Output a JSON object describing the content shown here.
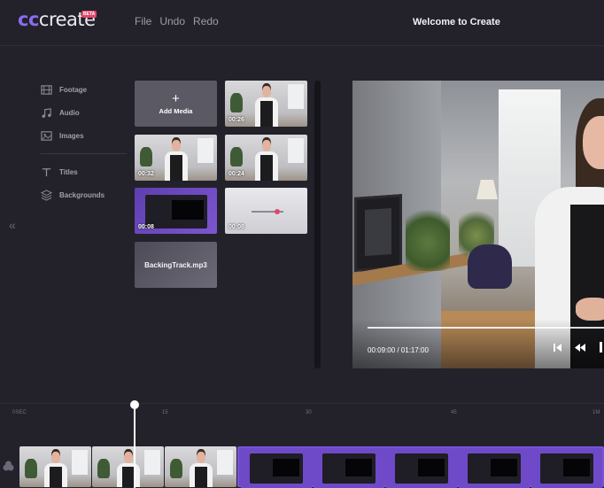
{
  "app": {
    "logo_prefix": "cc",
    "logo_name": "create",
    "badge": "BETA",
    "title": "Welcome to Create"
  },
  "menu": [
    {
      "label": "File"
    },
    {
      "label": "Undo"
    },
    {
      "label": "Redo"
    }
  ],
  "sidebar": {
    "items": [
      {
        "label": "Footage",
        "icon": "film-icon"
      },
      {
        "label": "Audio",
        "icon": "music-note-icon"
      },
      {
        "label": "Images",
        "icon": "image-icon"
      },
      {
        "label": "Titles",
        "icon": "text-icon"
      },
      {
        "label": "Backgrounds",
        "icon": "layers-icon"
      }
    ],
    "collapse_glyph": "«"
  },
  "media": {
    "add_label": "Add Media",
    "add_glyph": "+",
    "tiles": [
      {
        "duration": "00:26"
      },
      {
        "duration": "00:32"
      },
      {
        "duration": "00:24"
      },
      {
        "duration": "00:08"
      },
      {
        "duration": "00:08"
      }
    ],
    "audio_label": "BackingTrack.mp3"
  },
  "preview": {
    "time": "00:09:00 / 01:17:00"
  },
  "timeline": {
    "ruler": [
      "0SEC",
      "15",
      "30",
      "45",
      "1M"
    ]
  },
  "colors": {
    "accent": "#8b6cf0",
    "clip_purple": "#6e4ac8",
    "badge": "#e0476a",
    "background": "#23222b"
  }
}
